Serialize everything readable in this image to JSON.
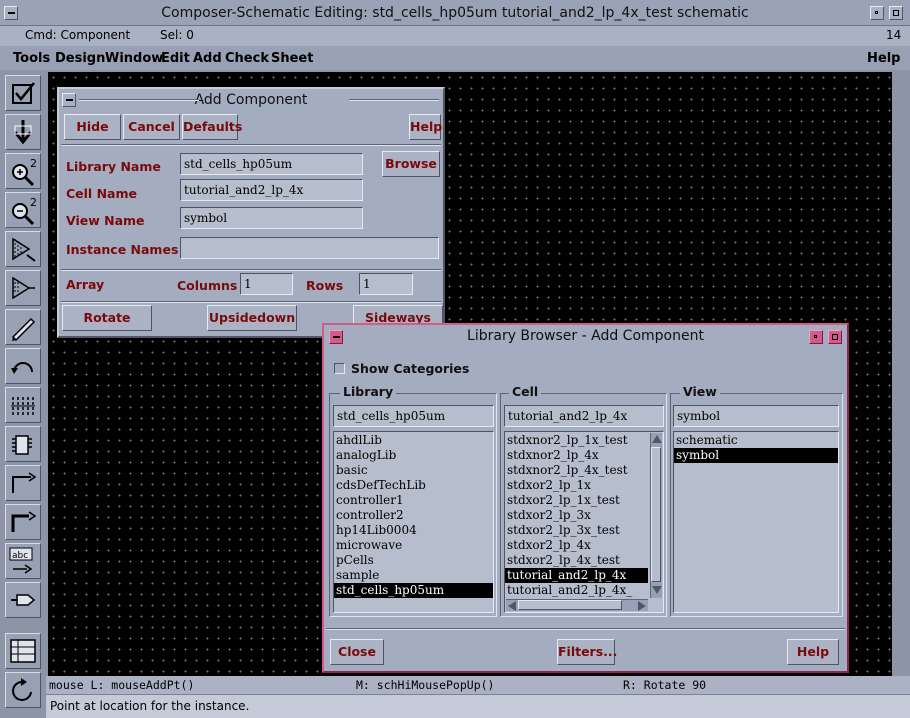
{
  "window": {
    "title": "Composer-Schematic Editing: std_cells_hp05um tutorial_and2_lp_4x_test schematic"
  },
  "status": {
    "cmd": "Cmd: Component",
    "sel": "Sel: 0",
    "number": "14"
  },
  "menu": [
    "Tools",
    "Design",
    "Window",
    "Edit",
    "Add",
    "Check",
    "Sheet"
  ],
  "menu_help": "Help",
  "toolbar": {
    "zoom_in_digit": "2",
    "zoom_out_digit": "2",
    "label_text": "abc"
  },
  "add_component": {
    "title": "Add Component",
    "buttons": {
      "hide": "Hide",
      "cancel": "Cancel",
      "defaults": "Defaults",
      "help": "Help",
      "browse": "Browse"
    },
    "labels": {
      "library": "Library Name",
      "cell": "Cell Name",
      "view": "View Name",
      "instance": "Instance Names",
      "array": "Array",
      "columns": "Columns",
      "rows": "Rows"
    },
    "values": {
      "library": "std_cells_hp05um",
      "cell": "tutorial_and2_lp_4x",
      "view": "symbol",
      "instance": "",
      "columns": "1",
      "rows": "1"
    },
    "bottom_buttons": {
      "rotate": "Rotate",
      "upsidedown": "Upsidedown",
      "sideways": "Sideways"
    }
  },
  "library_browser": {
    "title": "Library Browser - Add Component",
    "show_categories": "Show Categories",
    "headers": {
      "library": "Library",
      "cell": "Cell",
      "view": "View"
    },
    "filters": {
      "library": "std_cells_hp05um",
      "cell": "tutorial_and2_lp_4x",
      "view": "symbol"
    },
    "libraries": [
      "ahdlLib",
      "analogLib",
      "basic",
      "cdsDefTechLib",
      "controller1",
      "controller2",
      "hp14Lib0004",
      "microwave",
      "pCells",
      "sample",
      "std_cells_hp05um"
    ],
    "selected_library": "std_cells_hp05um",
    "cells": [
      "stdxnor2_lp_1x_test",
      "stdxnor2_lp_4x",
      "stdxnor2_lp_4x_test",
      "stdxor2_lp_1x",
      "stdxor2_lp_1x_test",
      "stdxor2_lp_3x",
      "stdxor2_lp_3x_test",
      "stdxor2_lp_4x",
      "stdxor2_lp_4x_test",
      "tutorial_and2_lp_4x",
      "tutorial_and2_lp_4x_"
    ],
    "selected_cell": "tutorial_and2_lp_4x",
    "views": [
      "schematic",
      "symbol"
    ],
    "selected_view": "symbol",
    "buttons": {
      "close": "Close",
      "filters": "Filters...",
      "help": "Help"
    }
  },
  "mouse": {
    "left": "mouse L: mouseAddPt()",
    "middle": "M: schHiMousePopUp()",
    "right": "R: Rotate 90"
  },
  "prompt": "Point at location for the instance.",
  "colors": {
    "canvas": "#000000",
    "dialog": "#a4acbf",
    "accent_text": "#7a0a0a",
    "browser_border": "#d25b8c"
  }
}
